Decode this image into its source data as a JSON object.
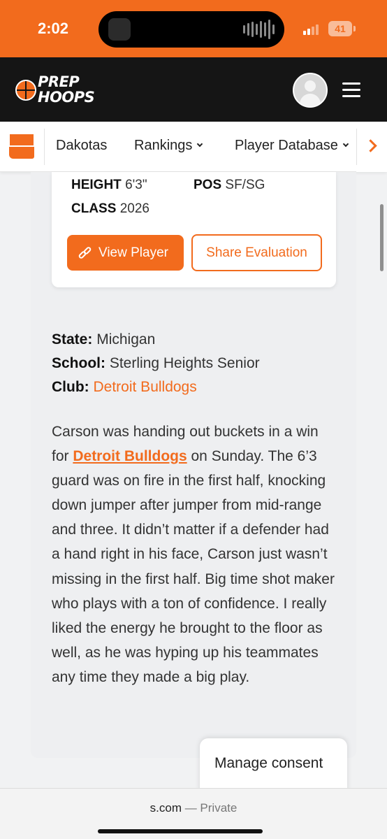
{
  "status_bar": {
    "time": "2:02",
    "battery": "41",
    "background_color": "#f26b1d",
    "icons": [
      "cellular-signal-icon",
      "battery-icon",
      "audio-waveform-icon"
    ]
  },
  "header": {
    "logo_line1": "PREP",
    "logo_line2": "HOOPS",
    "avatar_icon": "user-avatar-icon",
    "menu_icon": "hamburger-menu-icon",
    "background_color": "#151515"
  },
  "nav": {
    "state_icon": "dakotas-state-icon",
    "items": [
      {
        "label": "Dakotas"
      },
      {
        "label": "Rankings"
      },
      {
        "label": "Player Database"
      }
    ],
    "scroll_icon": "chevron-right-icon"
  },
  "player": {
    "height_label": "HEIGHT",
    "height_value": "6'3\"",
    "pos_label": "POS",
    "pos_value": "SF/SG",
    "class_label": "CLASS",
    "class_value": "2026",
    "view_button": "View Player",
    "share_button": "Share Evaluation"
  },
  "details": {
    "state_label": "State:",
    "state_value": "Michigan",
    "school_label": "School:",
    "school_value": "Sterling Heights Senior",
    "club_label": "Club:",
    "club_value": "Detroit Bulldogs"
  },
  "evaluation": {
    "text_before": "Carson was handing out buckets in a win for ",
    "link_text": "Detroit Bulldogs",
    "text_after": " on Sunday. The 6’3 guard was on fire in the first half, knocking down jumper after jumper from mid-range and three. It didn’t matter if a defender had a hand right in his face, Carson just wasn’t missing in the first half. Big time shot maker who plays with a ton of confidence. I really liked the energy he brought to the floor as well, as he was hyping up his teammates any time they made a big play."
  },
  "consent": {
    "label": "Manage consent"
  },
  "browser": {
    "domain": "s.com",
    "privacy": " — Private"
  },
  "colors": {
    "accent": "#f26b1d",
    "dark": "#151515",
    "page_bg": "#f1f2f3"
  }
}
